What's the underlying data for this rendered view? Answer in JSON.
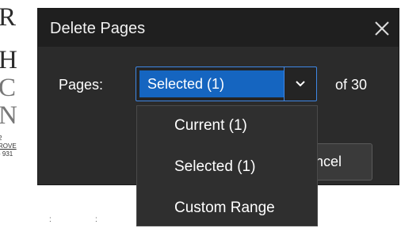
{
  "background_doc": {
    "lines": [
      "R",
      "H",
      "C",
      "N"
    ],
    "small_lines": [
      "2",
      "ROVE",
      "- 931"
    ],
    "bottom_marks": [
      ":",
      ":"
    ]
  },
  "dialog": {
    "title": "Delete Pages",
    "pages_label": "Pages:",
    "selected_value": "Selected (1)",
    "of_total": "of 30",
    "cancel_label": "ncel"
  },
  "dropdown": {
    "options": [
      "Current (1)",
      "Selected (1)",
      "Custom Range"
    ]
  },
  "colors": {
    "dialog_bg": "#2b2b2b",
    "titlebar_bg": "#1f1f1f",
    "accent": "#1565c0",
    "border_accent": "#3f88e6"
  },
  "icons": {
    "close": "close-icon",
    "dropdown": "chevron-down-icon"
  }
}
